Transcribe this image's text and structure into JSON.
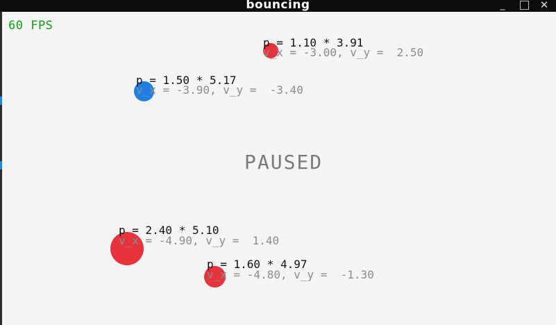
{
  "window": {
    "title": "bouncing",
    "minimize_glyph": "_",
    "close_glyph": "✕"
  },
  "hud": {
    "fps": "60 FPS",
    "status": "PAUSED"
  },
  "colors": {
    "red_ball": "#e8323c",
    "blue_ball": "#1f7fe0",
    "fps_text": "#10a010"
  },
  "balls": [
    {
      "color": "red",
      "momentum": "p = 1.10 * 3.91",
      "velocity": "v_x = -3.00, v_y =  2.50"
    },
    {
      "color": "blue",
      "momentum": "p = 1.50 * 5.17",
      "velocity": "v_x = -3.90, v_y =  -3.40"
    },
    {
      "color": "red",
      "momentum": "p = 2.40 * 5.10",
      "velocity": "v_x = -4.90, v_y =  1.40"
    },
    {
      "color": "red",
      "momentum": "p = 1.60 * 4.97",
      "velocity": "v_x = -4.80, v_y =  -1.30"
    }
  ]
}
